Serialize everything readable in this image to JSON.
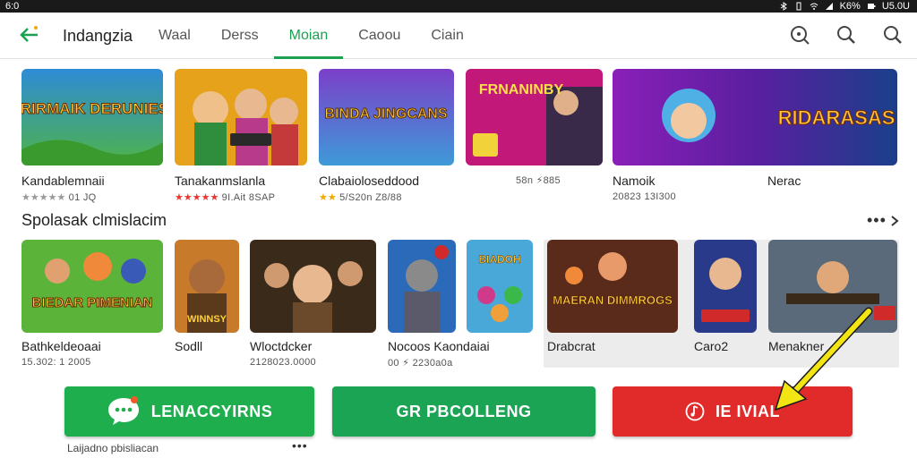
{
  "status_bar": {
    "left": "6:0",
    "right": "U5.0U",
    "battery": "K6%"
  },
  "header": {
    "title": "Indangzia",
    "tabs": [
      {
        "label": "Waal",
        "active": false
      },
      {
        "label": "Derss",
        "active": false
      },
      {
        "label": "Moian",
        "active": true
      },
      {
        "label": "Caoou",
        "active": false
      },
      {
        "label": "Ciain",
        "active": false
      }
    ]
  },
  "row1": [
    {
      "thumb_text": "IRIRMAIK DERUNIES",
      "title": "Kandablemnaii",
      "stars": "★★★★★",
      "meta": "01 JQ"
    },
    {
      "thumb_text": "",
      "title": "Tanakanmslanla",
      "stars": "★★★★★",
      "meta": "9I.Ait  8SAP"
    },
    {
      "thumb_text": "BINDA JINGCANS",
      "title": "Clabaioloseddood",
      "stars": "★★",
      "meta": "5/S20n  Z8/88"
    },
    {
      "thumb_text": "FRNANINBY",
      "title": "",
      "stars": "",
      "meta": "58n  ⚡885"
    },
    {
      "thumb_text": "RIDARASAS",
      "title": "Namoik",
      "stars": "",
      "meta": "20823 13I300"
    },
    {
      "thumb_text": "",
      "title": "Nerac",
      "stars": "",
      "meta": ""
    }
  ],
  "section2": {
    "title": "Spolasak clmislacim",
    "more": "•••"
  },
  "row2": [
    {
      "thumb_text": "BIEDAR PIMENIAN",
      "title": "Bathkeldeoaai",
      "meta": "15.302: 1 2005"
    },
    {
      "thumb_text": "WINNSY",
      "title": "Sodll",
      "meta": ""
    },
    {
      "thumb_text": "",
      "title": "Wloctdcker",
      "meta": "2128023.0000"
    },
    {
      "thumb_text": "",
      "title": "Nocoos Kaondaiai",
      "meta": "00  ⚡ 2230a0a"
    },
    {
      "thumb_text": "BIADOH",
      "title": "",
      "meta": ""
    },
    {
      "thumb_text": "MAERAN DIMMROGS",
      "title": "Drabcrat",
      "meta": ""
    },
    {
      "thumb_text": "",
      "title": "Caro2",
      "meta": ""
    },
    {
      "thumb_text": "",
      "title": "Menakner",
      "meta": ""
    }
  ],
  "buttons": [
    {
      "label": "LENACCYIRNS",
      "icon": "chat-bubble-icon",
      "color": "#1eae4e"
    },
    {
      "label": "GR PBCOLLENG",
      "icon": "",
      "color": "#1aa454"
    },
    {
      "label": "IE IVIAL",
      "icon": "music-note-icon",
      "color": "#e12a2a"
    }
  ],
  "footer": {
    "text": "Laijadno pbisliacan",
    "more": "•••"
  },
  "colors": {
    "accent": "#1aa251",
    "red": "#e12a2a",
    "annotation": "#f3e514"
  }
}
